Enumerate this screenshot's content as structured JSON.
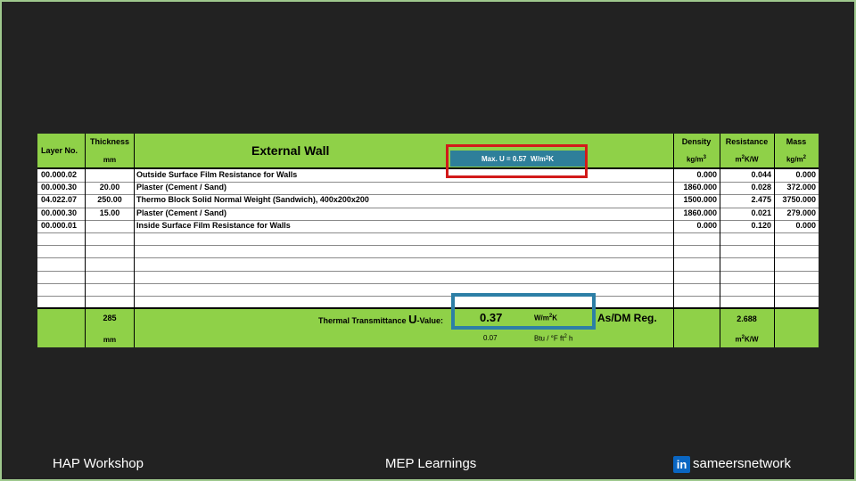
{
  "header": {
    "layer_no": "Layer No.",
    "thickness": "Thickness",
    "thickness_unit": "mm",
    "title": "External Wall",
    "max_u_label": "Max. U  =  0.57",
    "max_u_unit": "W/m",
    "max_u_unit_tail": "K",
    "density": "Density",
    "density_unit": "kg/m",
    "resistance": "Resistance",
    "resistance_unit": "m",
    "resistance_unit_tail": "K/W",
    "mass": "Mass",
    "mass_unit": "kg/m"
  },
  "rows": [
    {
      "layer": "00.000.02",
      "thickness": "",
      "description": "Outside Surface Film Resistance for Walls",
      "density": "0.000",
      "resistance": "0.044",
      "mass": "0.000"
    },
    {
      "layer": "00.000.30",
      "thickness": "20.00",
      "description": "Plaster (Cement / Sand)",
      "density": "1860.000",
      "resistance": "0.028",
      "mass": "372.000"
    },
    {
      "layer": "04.022.07",
      "thickness": "250.00",
      "description": "Thermo Block Solid Normal Weight (Sandwich), 400x200x200",
      "density": "1500.000",
      "resistance": "2.475",
      "mass": "3750.000"
    },
    {
      "layer": "00.000.30",
      "thickness": "15.00",
      "description": "Plaster (Cement / Sand)",
      "density": "1860.000",
      "resistance": "0.021",
      "mass": "279.000"
    },
    {
      "layer": "00.000.01",
      "thickness": "",
      "description": "Inside Surface Film Resistance for Walls",
      "density": "0.000",
      "resistance": "0.120",
      "mass": "0.000"
    }
  ],
  "totals": {
    "thickness": "285",
    "thickness_unit": "mm",
    "u_label": "Thermal Transmittance",
    "u_big": "U",
    "u_suffix": "-Value:",
    "u_value": "0.37",
    "u_unit": "W/m",
    "u_unit_tail": "K",
    "imperial_value": "0.07",
    "imperial_unit": "Btu / °F ft",
    "imperial_unit_tail": " h",
    "regulation": "As/DM Reg.",
    "total_resistance": "2.688",
    "total_resistance_unit": "m",
    "total_resistance_unit_tail": "K/W"
  },
  "footer": {
    "left": "HAP Workshop",
    "center": "MEP Learnings",
    "right": "sameersnetwork",
    "linkedin_icon_text": "in"
  },
  "colors": {
    "header_green": "#8fd148",
    "max_u_teal": "#2e7f9a",
    "highlight_red": "#d21a1a",
    "highlight_blue": "#2d7fa6",
    "background": "#222222"
  }
}
